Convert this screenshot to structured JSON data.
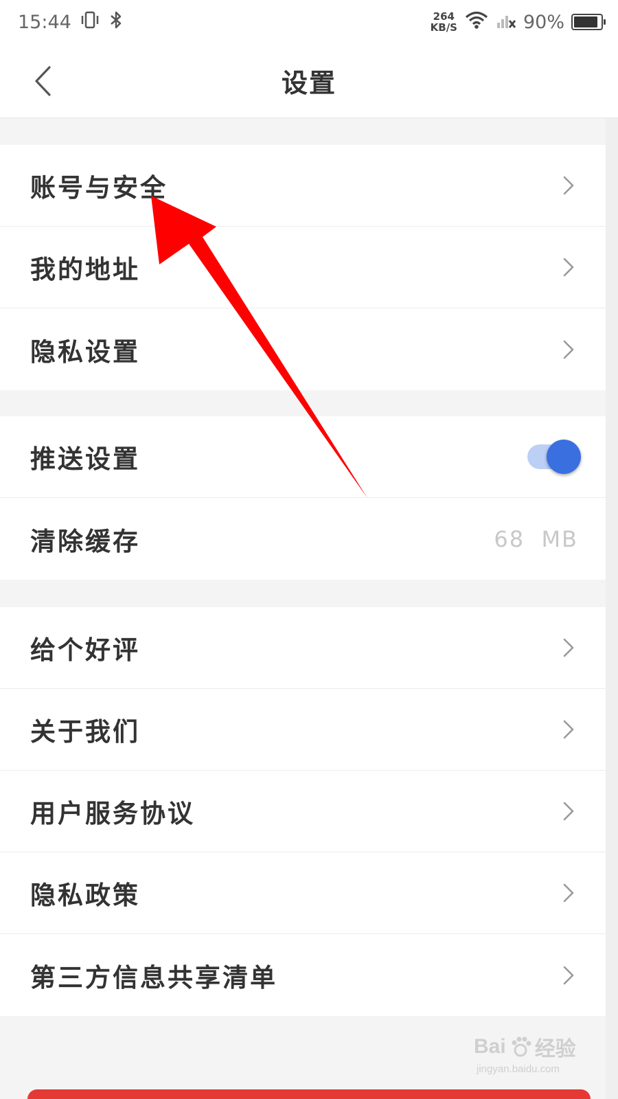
{
  "status_bar": {
    "time": "15:44",
    "net_speed_value": "264",
    "net_speed_unit": "KB/S",
    "battery_percent": "90%",
    "battery_level": 0.9,
    "icons": [
      "vibrate-icon",
      "bluetooth-icon",
      "wifi-icon",
      "signal-icon",
      "battery-icon"
    ]
  },
  "header": {
    "title": "设置",
    "back_icon": "chevron-left-icon"
  },
  "group1": {
    "items": [
      {
        "label": "账号与安全"
      },
      {
        "label": "我的地址"
      },
      {
        "label": "隐私设置"
      }
    ]
  },
  "group2": {
    "push": {
      "label": "推送设置",
      "enabled": true
    },
    "cache": {
      "label": "清除缓存",
      "value": "68  MB"
    }
  },
  "group3": {
    "items": [
      {
        "label": "给个好评"
      },
      {
        "label": "关于我们"
      },
      {
        "label": "用户服务协议"
      },
      {
        "label": "隐私政策"
      },
      {
        "label": "第三方信息共享清单"
      }
    ]
  },
  "watermark": {
    "brand": "Bai",
    "brand_suffix": "经验",
    "url": "jingyan.baidu.com"
  },
  "colors": {
    "accent_blue": "#3a6fe0",
    "annotation_arrow": "#ff0000",
    "logout_red": "#e53935"
  }
}
